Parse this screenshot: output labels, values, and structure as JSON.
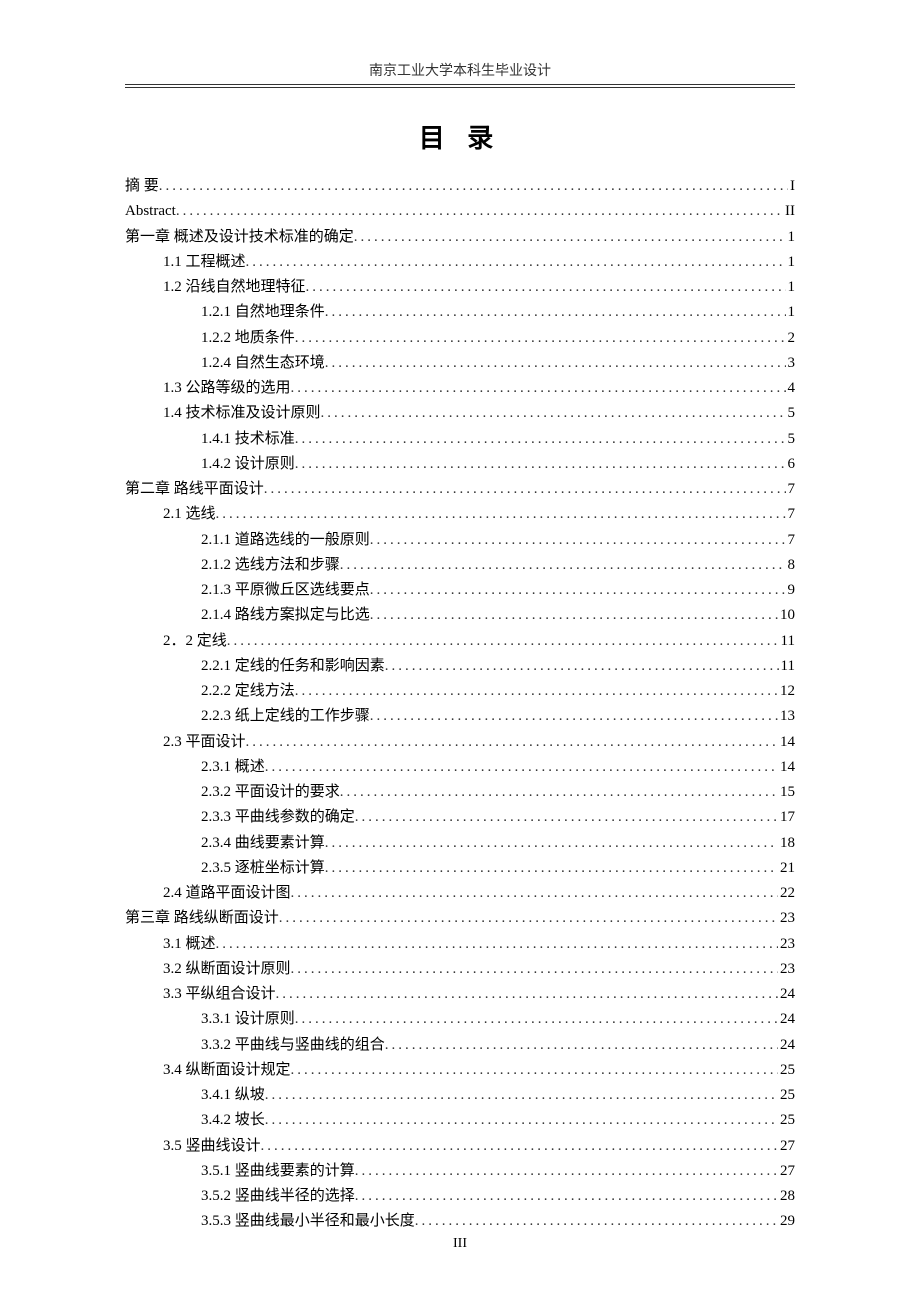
{
  "header": "南京工业大学本科生毕业设计",
  "title": "目 录",
  "footer": "III",
  "toc": [
    {
      "level": 0,
      "text": "摘 要",
      "page": "I"
    },
    {
      "level": 0,
      "text": "Abstract",
      "page": "II"
    },
    {
      "level": 0,
      "text": "第一章 概述及设计技术标准的确定",
      "page": "1"
    },
    {
      "level": 1,
      "text": "1.1 工程概述",
      "page": "1"
    },
    {
      "level": 1,
      "text": "1.2 沿线自然地理特征",
      "page": "1"
    },
    {
      "level": 2,
      "text": "1.2.1 自然地理条件 ",
      "page": "1"
    },
    {
      "level": 2,
      "text": "1.2.2 地质条件 ",
      "page": "2"
    },
    {
      "level": 2,
      "text": "1.2.4 自然生态环境 ",
      "page": "3"
    },
    {
      "level": 1,
      "text": "1.3 公路等级的选用",
      "page": "4"
    },
    {
      "level": 1,
      "text": "1.4 技术标准及设计原则",
      "page": "5"
    },
    {
      "level": 2,
      "text": "1.4.1 技术标准 ",
      "page": "5"
    },
    {
      "level": 2,
      "text": "1.4.2 设计原则 ",
      "page": "6"
    },
    {
      "level": 0,
      "text": "第二章 路线平面设计",
      "page": "7"
    },
    {
      "level": 1,
      "text": "2.1 选线",
      "page": "7"
    },
    {
      "level": 2,
      "text": "2.1.1 道路选线的一般原则 ",
      "page": "7"
    },
    {
      "level": 2,
      "text": "2.1.2 选线方法和步骤 ",
      "page": "8"
    },
    {
      "level": 2,
      "text": "2.1.3 平原微丘区选线要点 ",
      "page": "9"
    },
    {
      "level": 2,
      "text": "2.1.4 路线方案拟定与比选 ",
      "page": "10"
    },
    {
      "level": 1,
      "text": "2．2 定线",
      "page": "11"
    },
    {
      "level": 2,
      "text": "2.2.1 定线的任务和影响因素 ",
      "page": "11"
    },
    {
      "level": 2,
      "text": "2.2.2 定线方法 ",
      "page": "12"
    },
    {
      "level": 2,
      "text": "2.2.3 纸上定线的工作步骤 ",
      "page": "13"
    },
    {
      "level": 1,
      "text": "2.3 平面设计",
      "page": "14"
    },
    {
      "level": 2,
      "text": "2.3.1 概述 ",
      "page": "14"
    },
    {
      "level": 2,
      "text": "2.3.2 平面设计的要求 ",
      "page": "15"
    },
    {
      "level": 2,
      "text": "2.3.3 平曲线参数的确定 ",
      "page": "17"
    },
    {
      "level": 2,
      "text": "2.3.4 曲线要素计算 ",
      "page": "18"
    },
    {
      "level": 2,
      "text": "2.3.5 逐桩坐标计算 ",
      "page": "21"
    },
    {
      "level": 1,
      "text": "2.4 道路平面设计图",
      "page": "22"
    },
    {
      "level": 0,
      "text": "第三章 路线纵断面设计",
      "page": "23"
    },
    {
      "level": 1,
      "text": "3.1 概述",
      "page": "23"
    },
    {
      "level": 1,
      "text": "3.2 纵断面设计原则",
      "page": "23"
    },
    {
      "level": 1,
      "text": "3.3 平纵组合设计",
      "page": "24"
    },
    {
      "level": 2,
      "text": "3.3.1 设计原则 ",
      "page": "24"
    },
    {
      "level": 2,
      "text": "3.3.2 平曲线与竖曲线的组合 ",
      "page": "24"
    },
    {
      "level": 1,
      "text": "3.4 纵断面设计规定",
      "page": "25"
    },
    {
      "level": 2,
      "text": "3.4.1 纵坡 ",
      "page": "25"
    },
    {
      "level": 2,
      "text": "3.4.2 坡长 ",
      "page": "25"
    },
    {
      "level": 1,
      "text": "3.5 竖曲线设计",
      "page": "27"
    },
    {
      "level": 2,
      "text": "3.5.1 竖曲线要素的计算 ",
      "page": "27"
    },
    {
      "level": 2,
      "text": "3.5.2 竖曲线半径的选择 ",
      "page": "28"
    },
    {
      "level": 2,
      "text": "3.5.3 竖曲线最小半径和最小长度 ",
      "page": "29"
    }
  ]
}
